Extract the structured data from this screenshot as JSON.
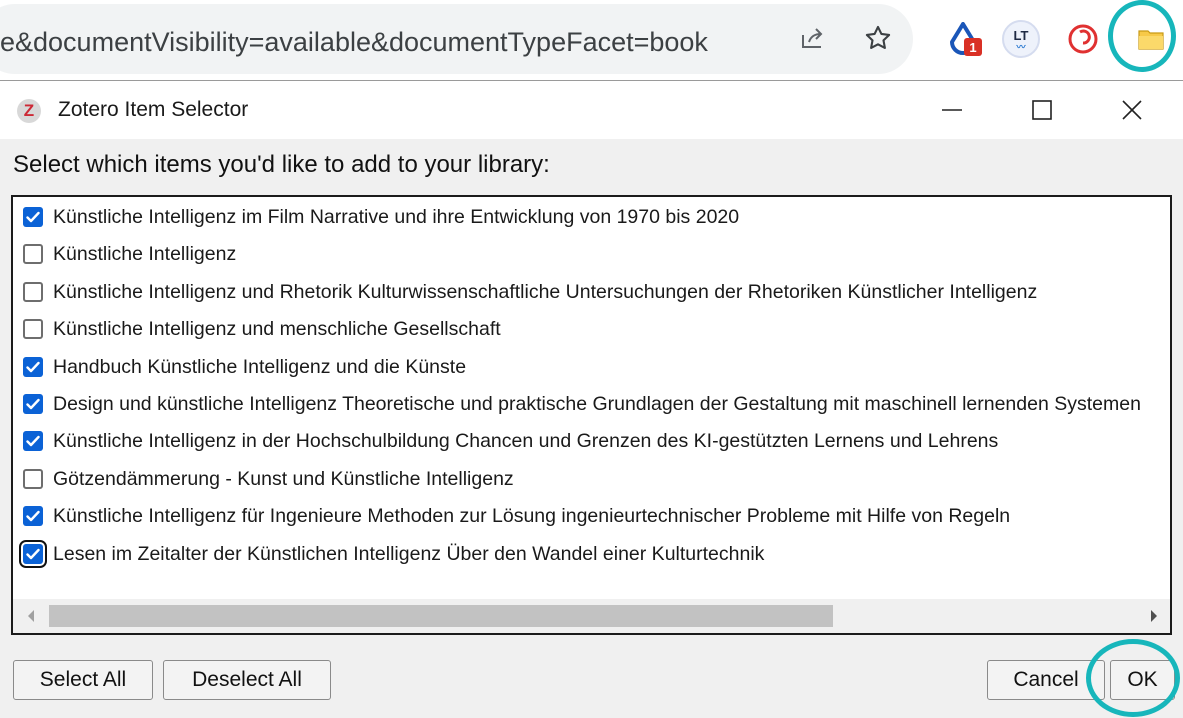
{
  "browser": {
    "url": "e&documentVisibility=available&documentTypeFacet=book",
    "share_icon": "share-icon",
    "bookmark_icon": "star-icon",
    "extensions": [
      {
        "icon": "drop-icon",
        "badge": "1"
      },
      {
        "icon": "languagetool-icon",
        "text": "LT"
      },
      {
        "icon": "red-c-icon"
      },
      {
        "icon": "zotero-folder-icon"
      }
    ],
    "accent": "#17b6bb"
  },
  "dialog": {
    "title": "Zotero Item Selector",
    "logo": "Z",
    "minimize_icon": "minimize-icon",
    "maximize_icon": "maximize-icon",
    "close_icon": "close-icon",
    "prompt": "Select which items you'd like to add to your library:",
    "items": [
      {
        "label": "Künstliche Intelligenz im Film Narrative und ihre Entwicklung von 1970 bis 2020",
        "checked": true
      },
      {
        "label": "Künstliche Intelligenz",
        "checked": false
      },
      {
        "label": "Künstliche Intelligenz und Rhetorik Kulturwissenschaftliche Untersuchungen der Rhetoriken Künstlicher Intelligenz",
        "checked": false
      },
      {
        "label": "Künstliche Intelligenz und menschliche Gesellschaft",
        "checked": false
      },
      {
        "label": "Handbuch Künstliche Intelligenz und die Künste",
        "checked": true
      },
      {
        "label": "Design und künstliche Intelligenz Theoretische und praktische Grundlagen der Gestaltung mit maschinell lernenden Systemen",
        "checked": true
      },
      {
        "label": "Künstliche Intelligenz in der Hochschulbildung Chancen und Grenzen des KI-gestützten Lernens und Lehrens",
        "checked": true
      },
      {
        "label": "Götzendämmerung - Kunst und Künstliche Intelligenz",
        "checked": false
      },
      {
        "label": "Künstliche Intelligenz für Ingenieure Methoden zur Lösung ingenieurtechnischer Probleme mit Hilfe von Regeln",
        "checked": true
      },
      {
        "label": "Lesen im Zeitalter der Künstlichen Intelligenz Über den Wandel einer Kulturtechnik",
        "checked": true
      }
    ],
    "buttons": {
      "select_all": "Select All",
      "deselect_all": "Deselect All",
      "cancel": "Cancel",
      "ok": "OK"
    },
    "checkbox_color": "#0b62d6"
  }
}
